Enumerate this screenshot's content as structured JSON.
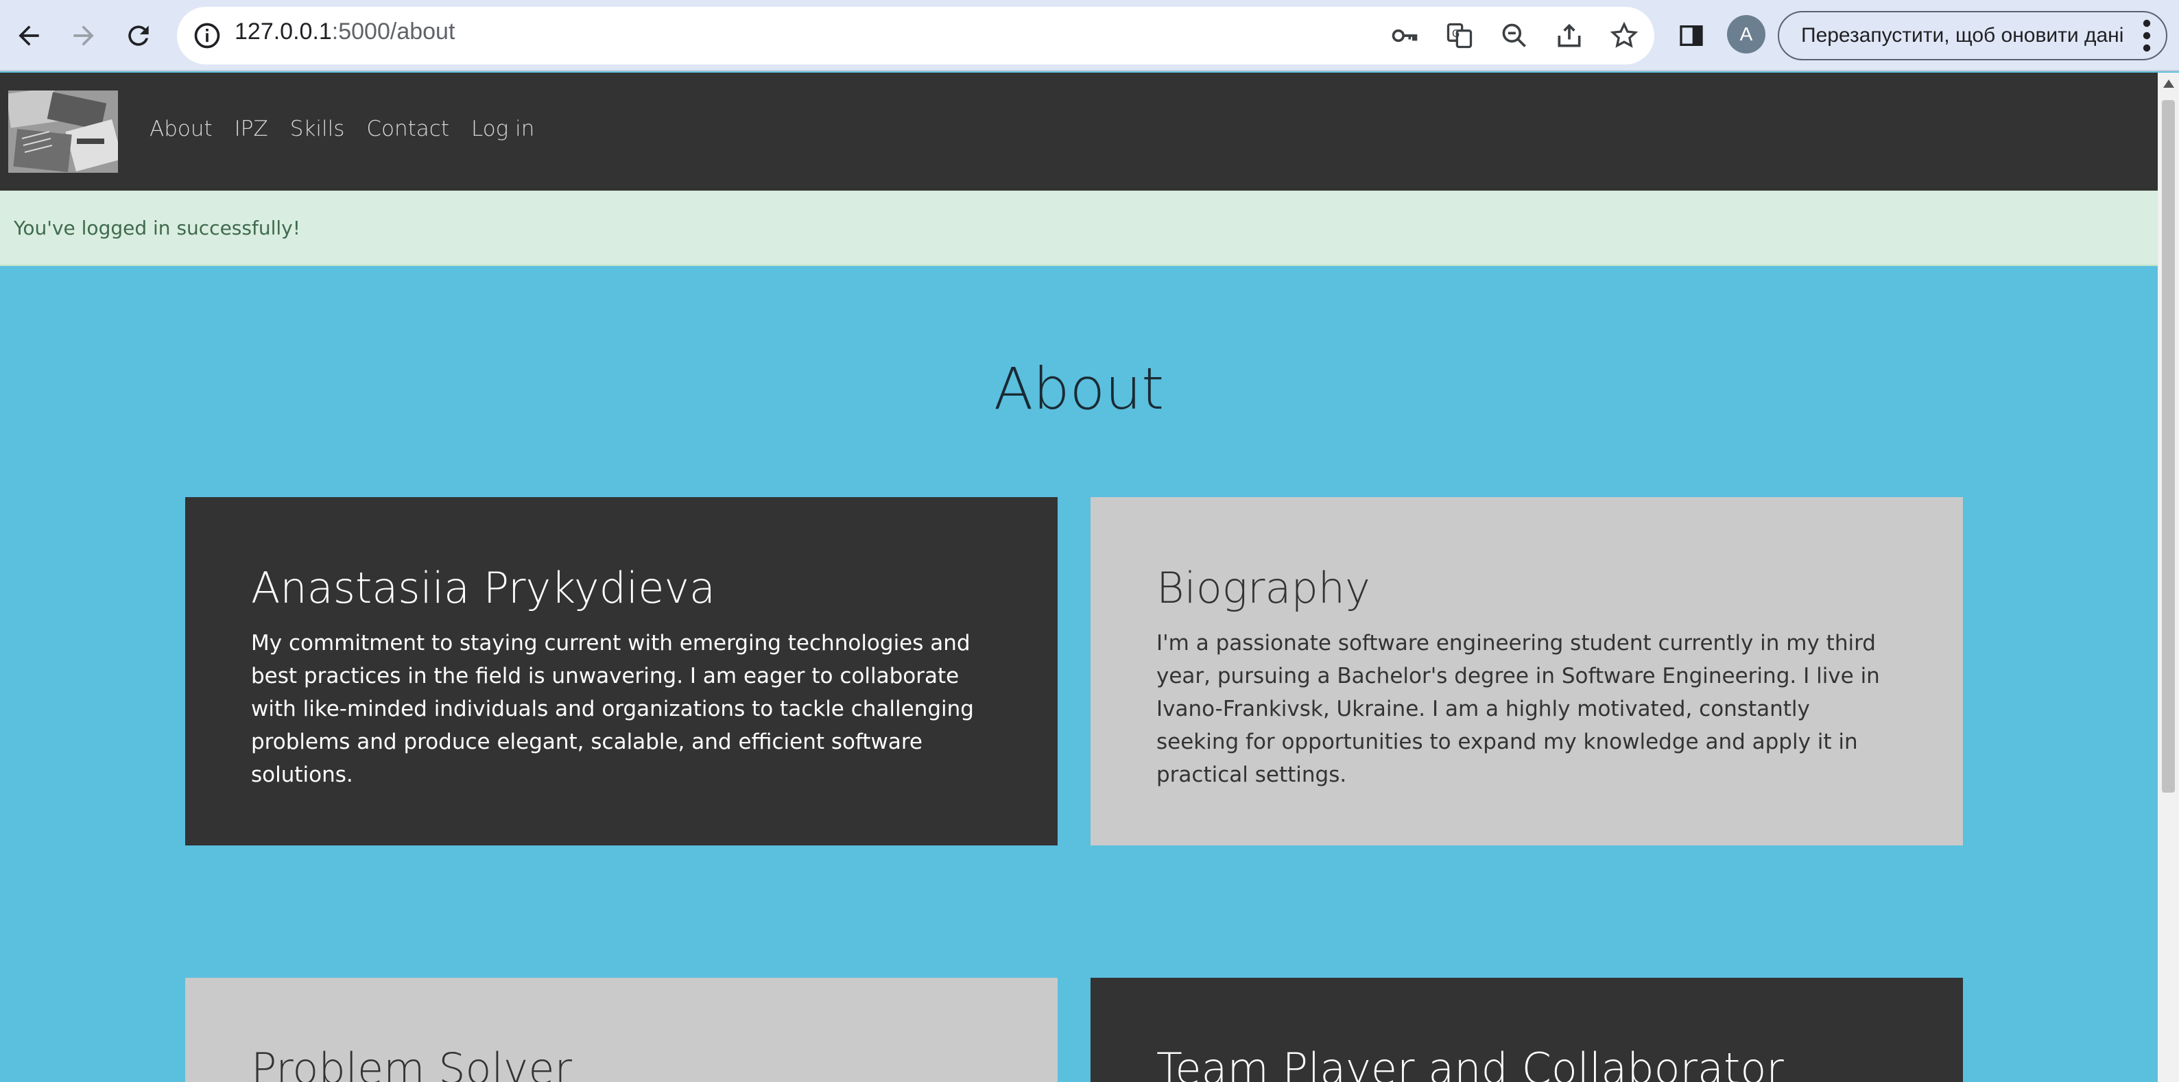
{
  "browser": {
    "url_host": "127.0.0.1",
    "url_path": ":5000/about",
    "profile_initial": "A",
    "restart_label": "Перезапустити, щоб оновити дані"
  },
  "site": {
    "nav": [
      {
        "label": "About"
      },
      {
        "label": "IPZ"
      },
      {
        "label": "Skills"
      },
      {
        "label": "Contact"
      },
      {
        "label": "Log in"
      }
    ],
    "flash_message": "You've logged in successfully!",
    "page_title": "About",
    "cards": [
      {
        "title": "Anastasiia Prykydieva",
        "text": "My commitment to staying current with emerging technologies and best practices in the field is unwavering. I am eager to collaborate with like-minded individuals and organizations to tackle challenging problems and produce elegant, scalable, and efficient software solutions.",
        "theme": "dark"
      },
      {
        "title": "Biography",
        "text": "I'm a passionate software engineering student currently in my third year, pursuing a Bachelor's degree in Software Engineering. I live in Ivano-Frankivsk, Ukraine. I am a highly motivated, constantly seeking for opportunities to expand my knowledge and apply it in practical settings.",
        "theme": "light"
      },
      {
        "title": "Problem Solver",
        "text": "",
        "theme": "light"
      },
      {
        "title": "Team Player and Collaborator",
        "text": "",
        "theme": "dark"
      }
    ]
  },
  "colors": {
    "page_bg": "#5bbfde",
    "nav_bg": "#333333",
    "flash_bg": "#d9ede0",
    "card_dark": "#333333",
    "card_light": "#cacaca"
  }
}
